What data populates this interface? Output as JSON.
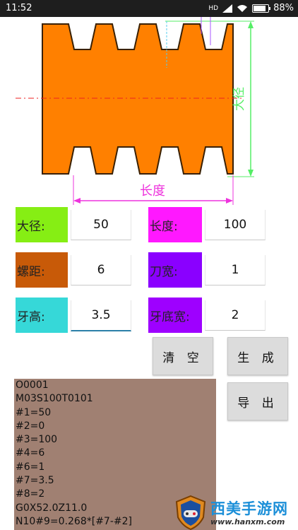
{
  "status_bar": {
    "time": "11:52",
    "signal_text": "HD",
    "battery_percent": "88%"
  },
  "diagram": {
    "dim_major_label": "大径",
    "dim_length_label": "长度",
    "body_color": "#ff8000",
    "dim_green": "#55ee66",
    "dim_magenta": "#ee33dd"
  },
  "params": {
    "major_diameter": {
      "label": "大径:",
      "value": "50",
      "color": "#86ee14"
    },
    "length": {
      "label": "长度:",
      "value": "100",
      "color": "#ff18ff"
    },
    "pitch": {
      "label": "螺距:",
      "value": "6",
      "color": "#c85a08"
    },
    "tool_width": {
      "label": "刀宽:",
      "value": "1",
      "color": "#8a00ff"
    },
    "thread_height": {
      "label": "牙高:",
      "value": "3.5",
      "color": "#36d8d8"
    },
    "root_width": {
      "label": "牙底宽:",
      "value": "2",
      "color": "#9e00ff"
    }
  },
  "buttons": {
    "clear": "清 空",
    "generate": "生 成",
    "export": "导 出"
  },
  "code_lines": [
    "O0001",
    "M03S100T0101",
    "#1=50",
    "#2=0",
    "#3=100",
    "#4=6",
    "#6=1",
    "#7=3.5",
    "#8=2",
    "G0X52.0Z11.0",
    "N10#9=0.268*[#7-#2]"
  ],
  "watermark": {
    "title": "西美手游网",
    "url": "www.hanxm.com"
  }
}
